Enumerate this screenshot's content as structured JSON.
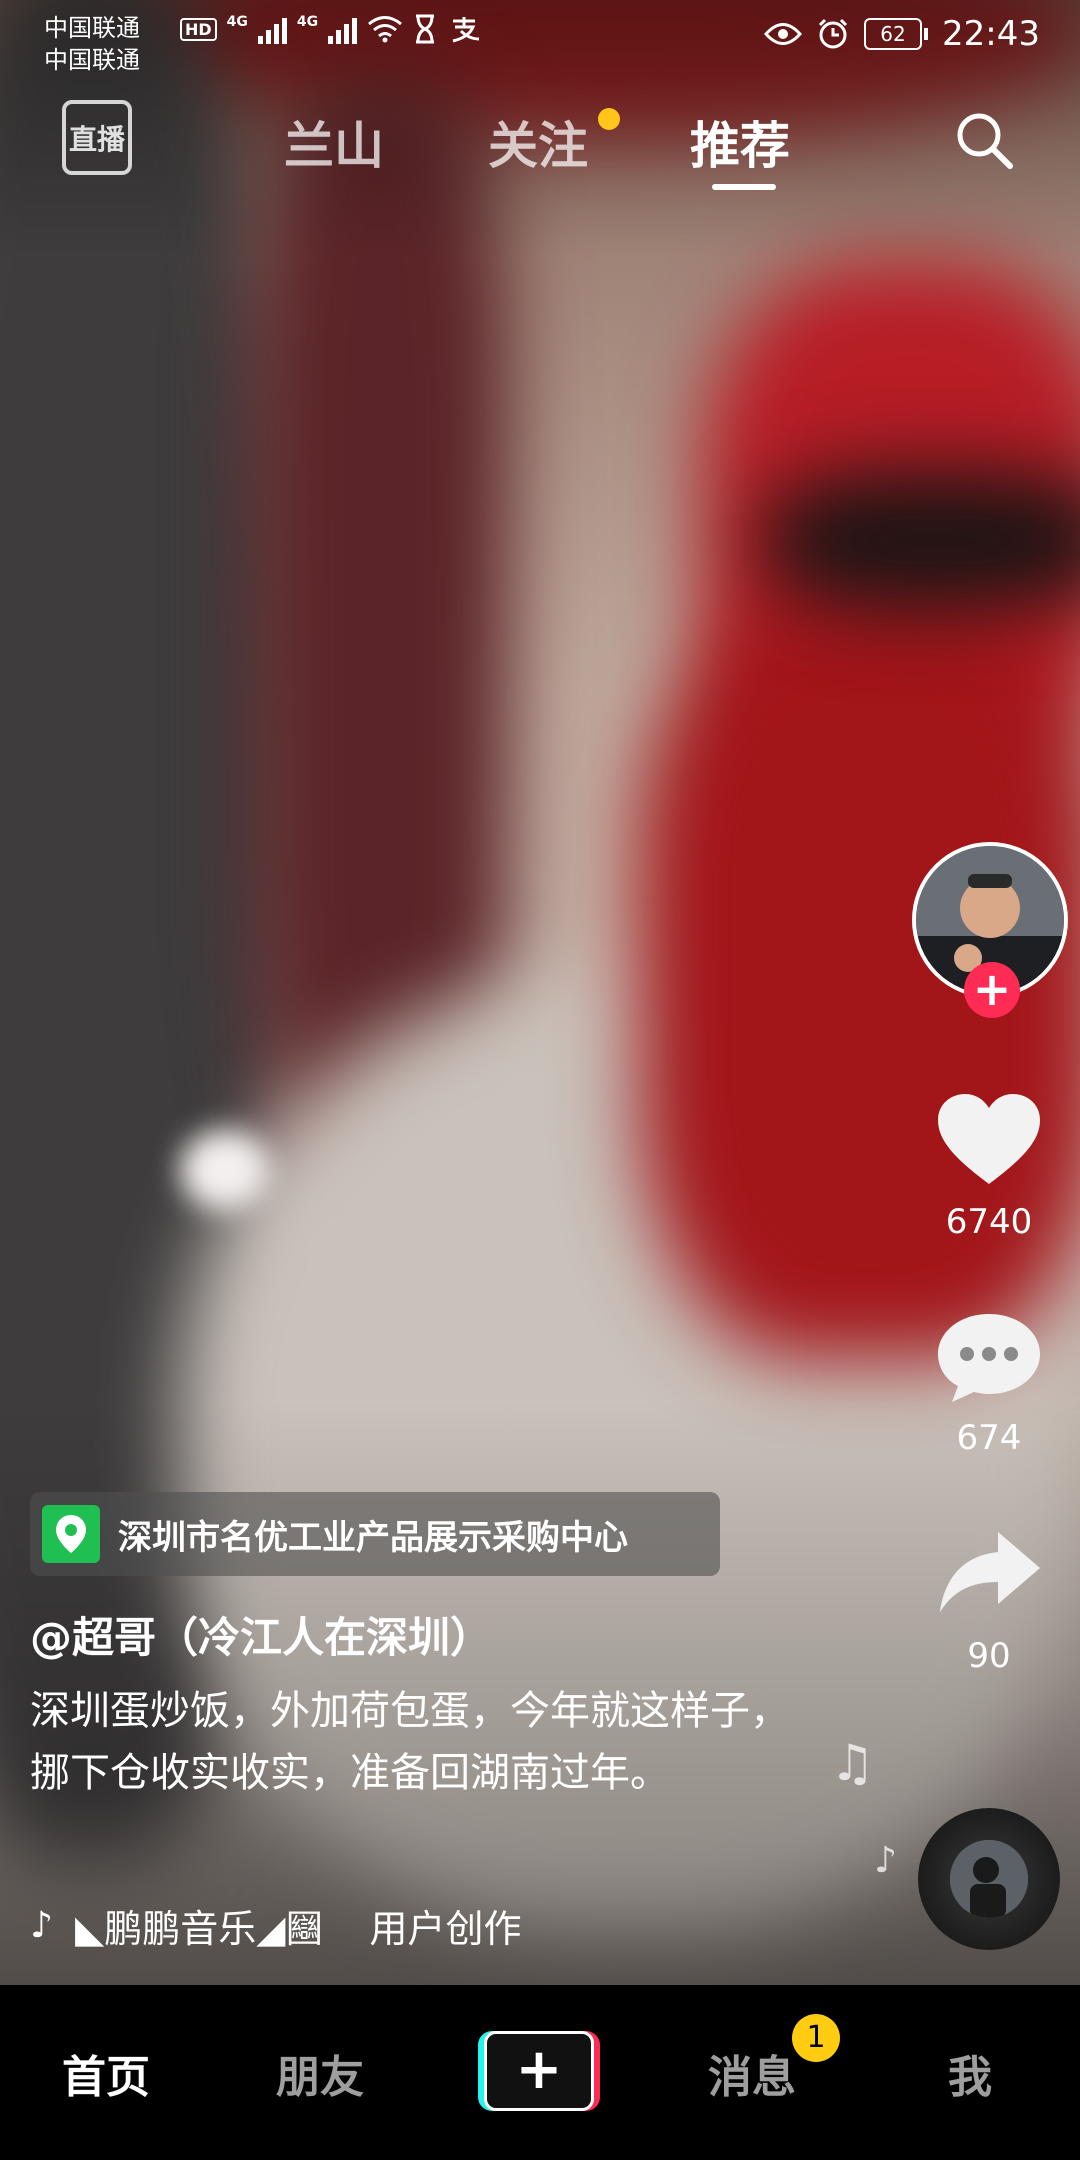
{
  "status_bar": {
    "carrier_1": "中国联通",
    "carrier_2": "中国联通",
    "hd_label": "HD",
    "network_1": "4G",
    "network_2": "4G",
    "battery": "62",
    "time": "22:43",
    "icons": [
      "signal-icon",
      "wifi-icon",
      "hourglass-icon",
      "alipay-icon",
      "eye-icon",
      "alarm-icon",
      "battery-icon"
    ]
  },
  "top_nav": {
    "live_label": "直播",
    "tabs": [
      {
        "label": "兰山"
      },
      {
        "label": "关注",
        "has_dot": true
      },
      {
        "label": "推荐",
        "active": true
      }
    ]
  },
  "right_rail": {
    "likes": "6740",
    "comments": "674",
    "shares": "90"
  },
  "caption": {
    "location": "深圳市名优工业产品展示采购中心",
    "author": "@超哥（冷江人在深圳）",
    "description": "深圳蛋炒饭，外加荷包蛋，今年就这样子，挪下仓收实收实，准备回湖南过年。",
    "music_title": "◣鹏鹏音乐◢圝",
    "music_source": "用户创作"
  },
  "bottom_nav": {
    "home": "首页",
    "friends": "朋友",
    "create": "+",
    "messages": "消息",
    "messages_badge": "1",
    "me": "我"
  },
  "colors": {
    "accent_pink": "#fe2c55",
    "accent_cyan": "#25f4ee",
    "badge_yellow": "#ffcc12",
    "location_green": "#1fbf52"
  }
}
